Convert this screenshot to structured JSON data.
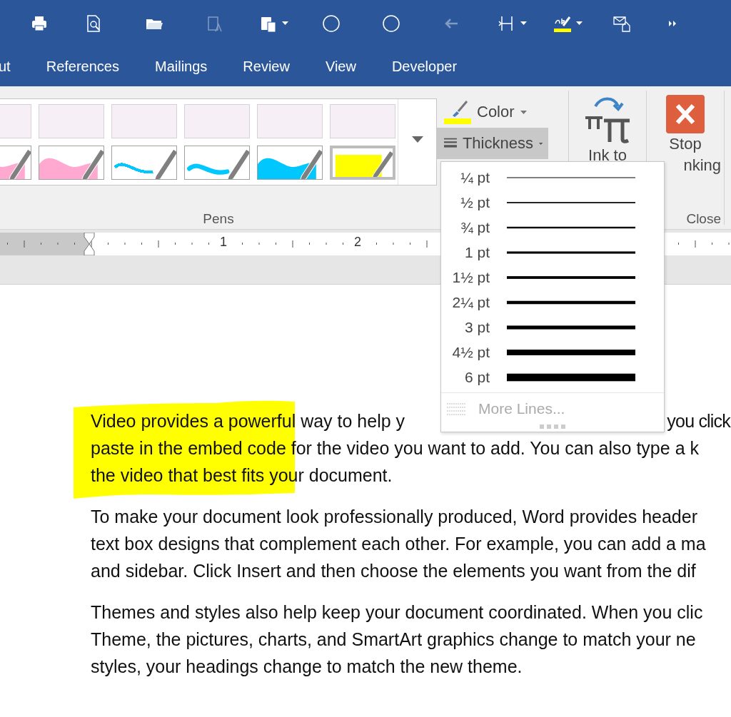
{
  "quick_access": [
    {
      "kind": "print",
      "disabled": false,
      "dropdown": false
    },
    {
      "kind": "preview",
      "disabled": false,
      "dropdown": false
    },
    {
      "kind": "open",
      "disabled": false,
      "dropdown": false
    },
    {
      "kind": "clipboard",
      "disabled": true,
      "dropdown": false
    },
    {
      "kind": "paste",
      "disabled": false,
      "dropdown": true
    },
    {
      "kind": "circle",
      "disabled": false,
      "dropdown": false
    },
    {
      "kind": "circle",
      "disabled": false,
      "dropdown": false
    },
    {
      "kind": "back",
      "disabled": true,
      "dropdown": false
    },
    {
      "kind": "columns",
      "disabled": false,
      "dropdown": true
    },
    {
      "kind": "highlight",
      "disabled": false,
      "dropdown": true
    },
    {
      "kind": "envelope",
      "disabled": false,
      "dropdown": false
    },
    {
      "kind": "more",
      "disabled": false,
      "dropdown": false
    }
  ],
  "tabs": [
    {
      "label": "ut",
      "selected": false
    },
    {
      "label": "References",
      "selected": false
    },
    {
      "label": "Mailings",
      "selected": false
    },
    {
      "label": "Review",
      "selected": false
    },
    {
      "label": "View",
      "selected": false
    },
    {
      "label": "Developer",
      "selected": false
    }
  ],
  "pens": {
    "group_label": "Pens",
    "items": [
      {
        "kind": "blob",
        "color": "#ffa8d0",
        "selected": false
      },
      {
        "kind": "blob",
        "color": "#ffa8d0",
        "selected": false
      },
      {
        "kind": "line",
        "color": "#00c8ff",
        "selected": false
      },
      {
        "kind": "stroke",
        "color": "#00c8ff",
        "selected": false
      },
      {
        "kind": "blob",
        "color": "#00c8ff",
        "selected": false
      },
      {
        "kind": "marker",
        "color": "#ffff00",
        "selected": true
      }
    ]
  },
  "color_button": {
    "label": "Color"
  },
  "thickness_button": {
    "label": "Thickness",
    "expanded": true
  },
  "ink_to_math": {
    "label": "Ink to"
  },
  "stop_inking": {
    "label_lines": [
      "Stop",
      "nking"
    ],
    "group_label": "Close"
  },
  "ruler": {
    "labels": [
      "1",
      "2"
    ]
  },
  "thickness_menu": {
    "items": [
      {
        "label": "¼ pt"
      },
      {
        "label": "½ pt"
      },
      {
        "label": "¾ pt"
      },
      {
        "label": "1 pt"
      },
      {
        "label": "1½ pt"
      },
      {
        "label": "2¼ pt"
      },
      {
        "label": "3 pt"
      },
      {
        "label": "4½ pt"
      },
      {
        "label": "6 pt"
      }
    ],
    "more": {
      "label": "More Lines...",
      "disabled": true
    }
  },
  "document": {
    "paragraphs": [
      [
        [
          "Video provides a powerful way to help y",
          "you click"
        ],
        "paste in the embed code for the video you want to add. You can also type a k",
        "the video that best fits your document."
      ],
      [
        "To make your document look professionally produced, Word provides header",
        "text box designs that complement each other. For example, you can add a ma",
        "and sidebar. Click Insert and then choose the elements you want from the dif"
      ],
      [
        "Themes and styles also help keep your document coordinated. When you clic",
        "Theme, the pictures, charts, and SmartArt graphics change to match your ne",
        "styles, your headings change to match the new theme."
      ]
    ]
  }
}
